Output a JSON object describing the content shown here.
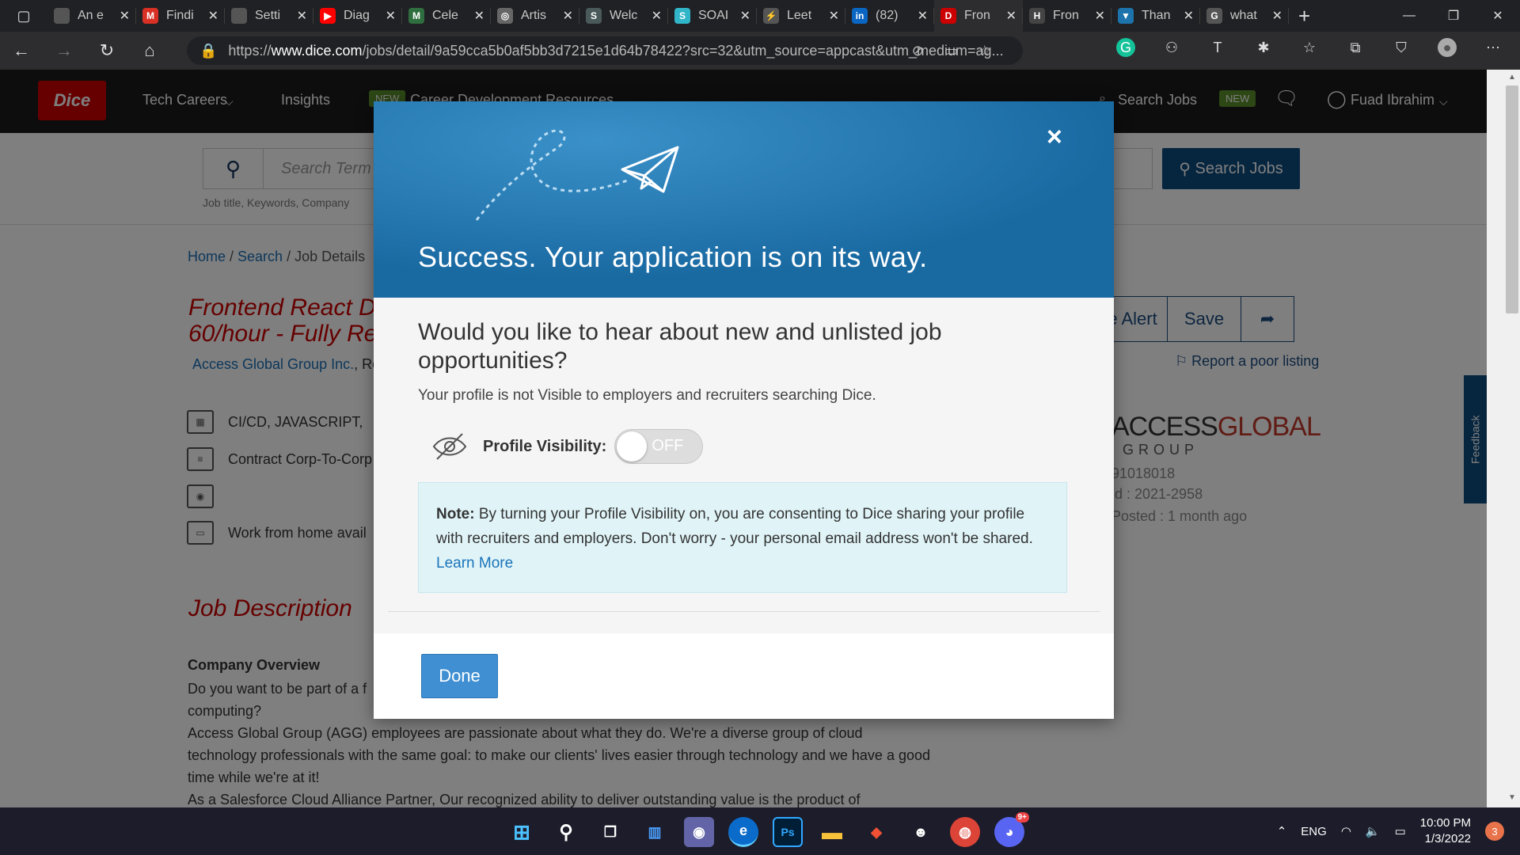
{
  "browser": {
    "tabs": [
      {
        "title": "An e",
        "fav_color": "#555"
      },
      {
        "title": "Findi",
        "fav_color": "#d93025",
        "fav": "M"
      },
      {
        "title": "Setti",
        "fav_color": "#555"
      },
      {
        "title": "Diag",
        "fav_color": "#ff0000",
        "fav": "▶"
      },
      {
        "title": "Cele",
        "fav_color": "#2f6f3f",
        "fav": "M"
      },
      {
        "title": "Artis",
        "fav_color": "#666",
        "fav": "◎"
      },
      {
        "title": "Welc",
        "fav_color": "#4a5a5a",
        "fav": "S"
      },
      {
        "title": "SOAI",
        "fav_color": "#31b5c8",
        "fav": "S"
      },
      {
        "title": "Leet",
        "fav_color": "#555",
        "fav": "⚡"
      },
      {
        "title": "(82)",
        "fav_color": "#0a66c2",
        "fav": "in"
      },
      {
        "title": "Fron",
        "fav_color": "#c00",
        "fav": "D"
      },
      {
        "title": "Fron",
        "fav_color": "#444",
        "fav": "H"
      },
      {
        "title": "Than",
        "fav_color": "#1d73ab",
        "fav": "▼"
      },
      {
        "title": "what",
        "fav_color": "#555",
        "fav": "G"
      }
    ],
    "url_prefix": "https://",
    "url_domain": "www.dice.com",
    "url_rest": "/jobs/detail/9a59cca5b0af5bb3d7215e1d64b78422?src=32&utm_source=appcast&utm_medium=ag..."
  },
  "nav": {
    "logo": "Dice",
    "tech_careers": "Tech Careers",
    "insights": "Insights",
    "new_badge": "NEW",
    "career_dev": "Career Development Resources",
    "search_jobs": "Search Jobs",
    "new_badge2": "NEW",
    "user": "Fuad Ibrahim"
  },
  "search": {
    "placeholder": "Search Term",
    "hint": "Job title, Keywords, Company",
    "button": "Search Jobs"
  },
  "breadcrumb": {
    "home": "Home",
    "search": "Search",
    "current": "Job Details"
  },
  "job": {
    "title_line1": "Frontend React Dev",
    "title_line2": "60/hour - Fully Rem",
    "company": "Access Global Group Inc.",
    "company_suffix": ", Re",
    "create_alert": "te Alert",
    "save": "Save",
    "report": "Report a poor listing",
    "skills": "CI/CD, JAVASCRIPT,",
    "employment": "Contract Corp-To-Corp",
    "remote": "Work from home avail",
    "feedback": "Feedback",
    "logo_a": "ACCESS",
    "logo_b": "GLOBAL",
    "logo_sub": "GROUP",
    "dice_id": "91018018",
    "position_id": "ld : 2021-2958",
    "posted": "Posted : 1 month ago",
    "description_title": "Job Description",
    "overview_heading": "Company Overview",
    "overview_p1": "Do you want to be part of a f",
    "overview_p1b": "computing?",
    "overview_p2": "Access Global Group (AGG) employees are passionate about what they do. We're a diverse group of cloud technology professionals with the same goal: to make our clients' lives easier through technology and we have a good time while we're at it!",
    "overview_p3": "As a Salesforce Cloud Alliance Partner, Our recognized ability to deliver outstanding value is the product of"
  },
  "modal": {
    "close": "×",
    "heading": "Success. Your application is on its way.",
    "question": "Would you like to hear about new and unlisted job opportunities?",
    "subtext": "Your profile is not Visible to employers and recruiters searching Dice.",
    "visibility_label": "Profile Visibility:",
    "toggle_state": "OFF",
    "note_label": "Note:",
    "note_text": " By turning your Profile Visibility on, you are consenting to Dice sharing your profile with recruiters and employers. Don't worry - your personal email address won't be shared. ",
    "learn_more": "Learn More",
    "done": "Done"
  },
  "taskbar": {
    "lang": "ENG",
    "time": "10:00 PM",
    "date": "1/3/2022",
    "notifications": "3",
    "discord_badge": "9+"
  },
  "colors": {
    "dice_red": "#cc0000",
    "modal_blue": "#1d73ab",
    "link_blue": "#1a6fb6",
    "done_blue": "#3f8fd2"
  }
}
